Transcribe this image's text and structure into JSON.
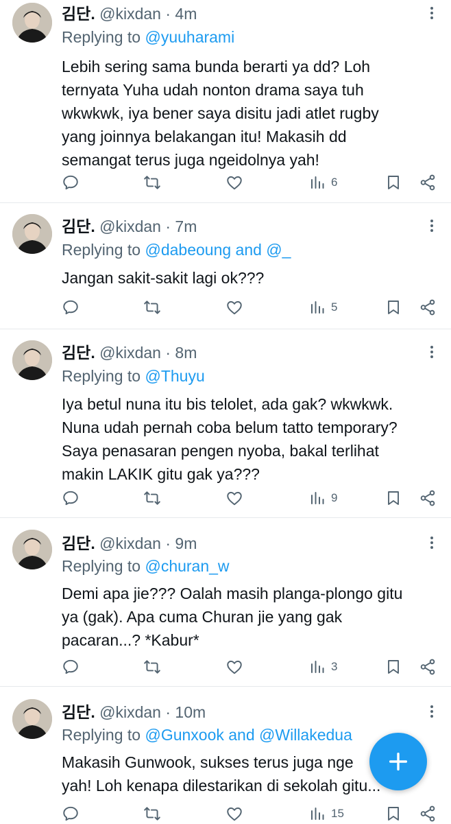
{
  "tweets": [
    {
      "name": "김단.",
      "handle": "@kixdan",
      "dot": "·",
      "time": "4m",
      "replying_prefix": "Replying to ",
      "mentions": "@yuuharami",
      "lines": [
        "Lebih sering sama bunda berarti ya dd? Loh",
        "ternyata Yuha udah nonton drama saya tuh",
        "wkwkwk, iya bener saya disitu jadi atlet rugby",
        "yang joinnya belakangan itu! Makasih dd",
        "semangat terus juga ngeidolnya yah!"
      ],
      "views": "6"
    },
    {
      "name": "김단.",
      "handle": "@kixdan",
      "dot": "·",
      "time": "7m",
      "replying_prefix": "Replying to ",
      "mentions": "@dabeoung and @_",
      "lines": [
        "Jangan sakit-sakit lagi ok???"
      ],
      "views": "5"
    },
    {
      "name": "김단.",
      "handle": "@kixdan",
      "dot": "·",
      "time": "8m",
      "replying_prefix": "Replying to ",
      "mentions": "@Thuyu",
      "lines": [
        "Iya betul nuna itu bis telolet, ada gak? wkwkwk.",
        "Nuna udah pernah coba belum tatto temporary?",
        "Saya penasaran pengen nyoba, bakal terlihat",
        "makin LAKIK gitu gak ya???"
      ],
      "views": "9"
    },
    {
      "name": "김단.",
      "handle": "@kixdan",
      "dot": "·",
      "time": "9m",
      "replying_prefix": "Replying to ",
      "mentions": "@churan_w",
      "lines": [
        "Demi apa jie??? Oalah masih planga-plongo gitu",
        "ya (gak). Apa cuma Churan jie yang gak",
        "pacaran...? *Kabur*"
      ],
      "views": "3"
    },
    {
      "name": "김단.",
      "handle": "@kixdan",
      "dot": "·",
      "time": "10m",
      "replying_prefix": "Replying to ",
      "mentions": "@Gunxook and @Willakedua",
      "lines": [
        "Makasih Gunwook, sukses terus juga nge",
        "yah! Loh kenapa dilestarikan di sekolah gitu..."
      ],
      "views": "15"
    }
  ],
  "icons": {
    "reply": "reply-icon",
    "retweet": "retweet-icon",
    "like": "like-icon",
    "views": "views-icon",
    "bookmark": "bookmark-icon",
    "share": "share-icon",
    "more": "more-icon",
    "compose": "compose-icon"
  },
  "colors": {
    "accent": "#1d9bf0",
    "text": "#0f1419",
    "muted": "#536471",
    "divider": "#e6e9ec"
  }
}
